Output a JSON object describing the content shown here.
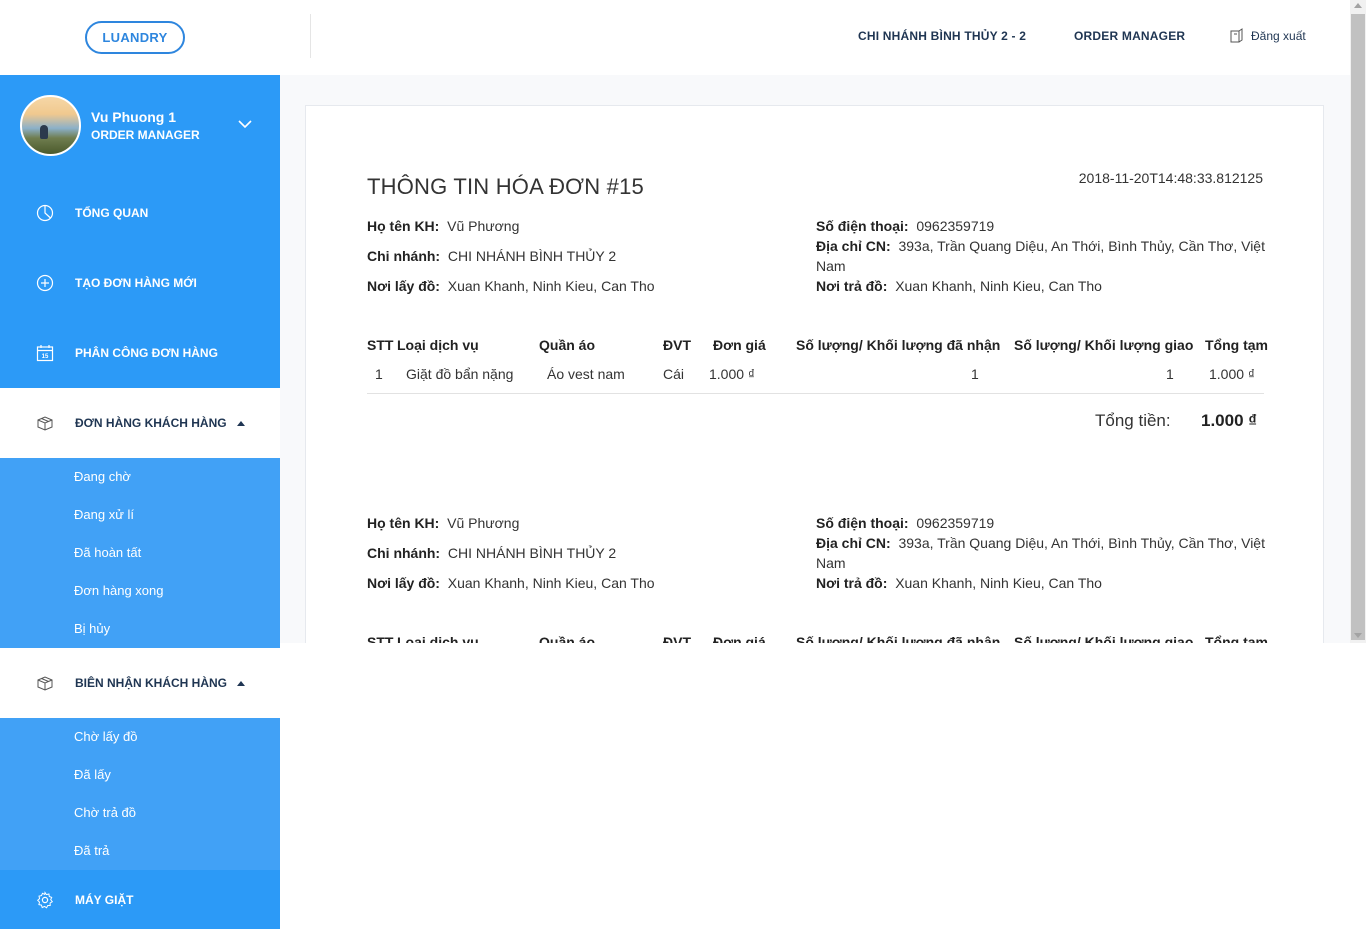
{
  "header": {
    "logo": "LUANDRY",
    "branch": "CHI NHÁNH BÌNH THỦY 2 - 2",
    "role": "ORDER MANAGER",
    "logout": "Đăng xuất"
  },
  "profile": {
    "name": "Vu Phuong 1",
    "role": "ORDER MANAGER"
  },
  "nav": {
    "overview": "TỔNG QUAN",
    "new_order": "TẠO ĐƠN HÀNG MỚI",
    "assign": "PHÂN CÔNG ĐƠN HÀNG",
    "customer_orders": "ĐƠN HÀNG KHÁCH HÀNG",
    "customer_orders_items": [
      "Đang chờ",
      "Đang xử lí",
      "Đã hoàn tất",
      "Đơn hàng xong",
      "Bị hủy"
    ],
    "receipts": "BIÊN NHẬN KHÁCH HÀNG",
    "receipts_items": [
      "Chờ lấy đồ",
      "Đã lấy",
      "Chờ trả đồ",
      "Đã trả"
    ],
    "washers": "MÁY GIẶT",
    "calendar_number": "15"
  },
  "invoice": {
    "title": "THÔNG TIN HÓA ĐƠN #15",
    "date": "2018-11-20T14:48:33.812125",
    "customer_label": "Họ tên KH:",
    "customer": "Vũ Phương",
    "branch_label": "Chi nhánh:",
    "branch": "CHI NHÁNH BÌNH THỦY 2",
    "pickup_label": "Nơi lấy đồ:",
    "pickup": "Xuan Khanh, Ninh Kieu, Can Tho",
    "phone_label": "Số điện thoại:",
    "phone": "0962359719",
    "address_label": "Địa chỉ CN:",
    "address_line1": "393a, Trần Quang Diệu, An Thới, Bình Thủy, Cần Thơ, Việt",
    "address_line2": "Nam",
    "delivery_label": "Nơi trả đồ:",
    "delivery": "Xuan Khanh, Ninh Kieu, Can Tho",
    "columns": [
      "STT",
      "Loại dịch vụ",
      "Quần áo",
      "ĐVT",
      "Đơn giá",
      "Số lượng/ Khối lượng đã nhận",
      "Số lượng/ Khối lượng giao",
      "Tổng tạm"
    ],
    "rows": [
      [
        "1",
        "Giặt đồ bẩn nặng",
        "Áo vest nam",
        "Cái",
        "1.000 ₫",
        "1",
        "1",
        "1.000 ₫"
      ]
    ],
    "total_label": "Tổng tiền:",
    "total": "1.000 ₫"
  }
}
